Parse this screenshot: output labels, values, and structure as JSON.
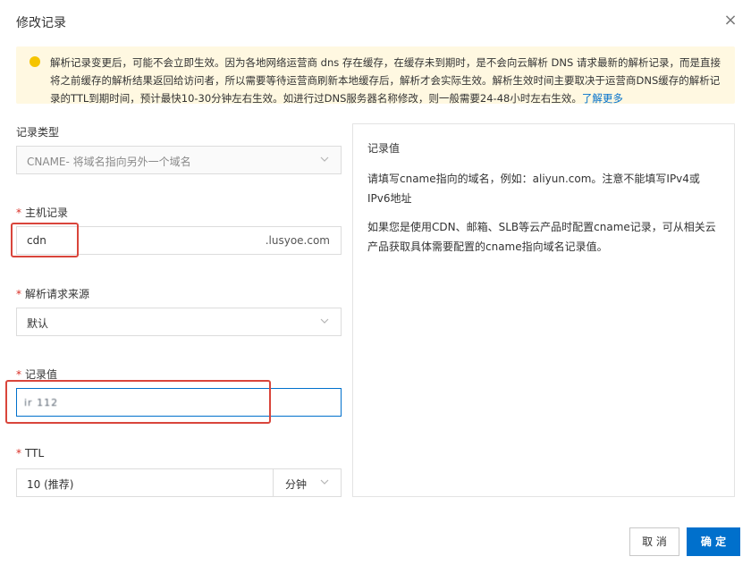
{
  "dialog": {
    "title": "修改记录",
    "close_label": "×"
  },
  "notice": {
    "text": "解析记录变更后，可能不会立即生效。因为各地网络运营商 dns 存在缓存，在缓存未到期时，是不会向云解析 DNS 请求最新的解析记录，而是直接将之前缓存的解析结果返回给访问者，所以需要等待运营商刷新本地缓存后，解析才会实际生效。解析生效时间主要取决于运营商DNS缓存的解析记录的TTL到期时间，预计最快10-30分钟左右生效。如进行过DNS服务器名称修改，则一般需要24-48小时左右生效。",
    "link": "了解更多",
    "icon": "warning-dot-icon",
    "color": "#f5c400"
  },
  "form": {
    "record_type": {
      "label": "记录类型",
      "value": "CNAME- 将域名指向另外一个域名"
    },
    "host": {
      "label": "主机记录",
      "required_mark": "*",
      "value": "cdn",
      "suffix": ".lusyoe.com"
    },
    "line": {
      "label": "解析请求来源",
      "required_mark": "*",
      "value": "默认"
    },
    "record_value": {
      "label": "记录值",
      "required_mark": "*",
      "value": "ir 112"
    },
    "ttl": {
      "label": "TTL",
      "required_mark": "*",
      "value": "10 (推荐)",
      "unit": "分钟"
    }
  },
  "help": {
    "title": "记录值",
    "para1": "请填写cname指向的域名，例如：aliyun.com。注意不能填写IPv4或IPv6地址",
    "para2": "如果您是使用CDN、邮箱、SLB等云产品时配置cname记录，可从相关云产品获取具体需要配置的cname指向域名记录值。"
  },
  "footer": {
    "cancel_label": "取 消",
    "ok_label": "确 定"
  },
  "colors": {
    "primary": "#0070cc",
    "highlight": "#d9453b",
    "required": "#d93026"
  }
}
